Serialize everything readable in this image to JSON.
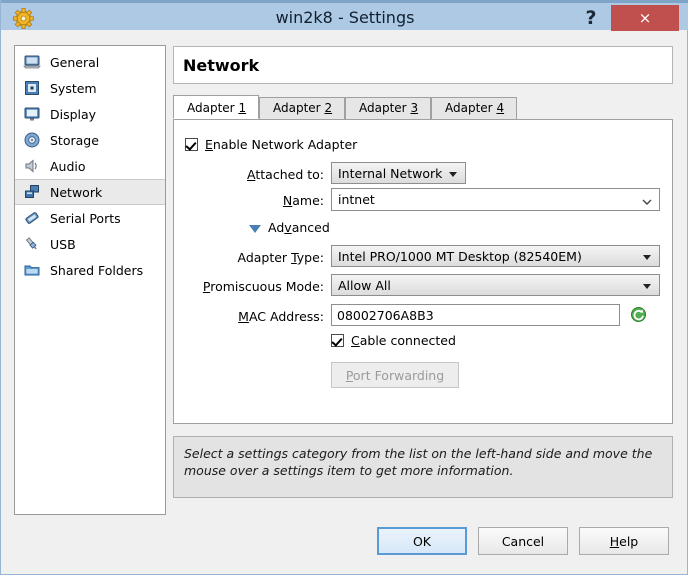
{
  "titlebar": {
    "title": "win2k8 - Settings",
    "gear_icon": "vbox-gear-icon",
    "help_label": "?",
    "close_label": "×"
  },
  "sidebar": {
    "items": [
      {
        "label": "General",
        "icon": "monitor-icon",
        "selected": false
      },
      {
        "label": "System",
        "icon": "chip-icon",
        "selected": false
      },
      {
        "label": "Display",
        "icon": "display-icon",
        "selected": false
      },
      {
        "label": "Storage",
        "icon": "disc-icon",
        "selected": false
      },
      {
        "label": "Audio",
        "icon": "speaker-icon",
        "selected": false
      },
      {
        "label": "Network",
        "icon": "network-icon",
        "selected": true
      },
      {
        "label": "Serial Ports",
        "icon": "serial-port-icon",
        "selected": false
      },
      {
        "label": "USB",
        "icon": "usb-icon",
        "selected": false
      },
      {
        "label": "Shared Folders",
        "icon": "shared-folder-icon",
        "selected": false
      }
    ]
  },
  "header": {
    "title": "Network"
  },
  "tabs": [
    {
      "label": "Adapter",
      "mnemonic": "1",
      "active": true
    },
    {
      "label": "Adapter",
      "mnemonic": "2",
      "active": false
    },
    {
      "label": "Adapter",
      "mnemonic": "3",
      "active": false
    },
    {
      "label": "Adapter",
      "mnemonic": "4",
      "active": false
    }
  ],
  "form": {
    "enable_adapter": {
      "label_pre": "E",
      "label_post": "nable Network Adapter",
      "checked": true
    },
    "attached_to": {
      "label_pre": "A",
      "label_post": "ttached to:",
      "value": "Internal Network"
    },
    "name": {
      "label_pre": "N",
      "label_post": "ame:",
      "value": "intnet"
    },
    "advanced": {
      "label_pre": "Ad",
      "label_mid": "v",
      "label_post": "anced",
      "expanded": true
    },
    "adapter_type": {
      "label_pre": "Adapter ",
      "label_mid": "T",
      "label_post": "ype:",
      "value": "Intel PRO/1000 MT Desktop (82540EM)"
    },
    "promiscuous_mode": {
      "label_pre": "P",
      "label_post": "romiscuous Mode:",
      "value": "Allow All"
    },
    "mac_address": {
      "label_pre": "M",
      "label_post": "AC Address:",
      "value": "08002706A8B3",
      "refresh_icon": "refresh-icon"
    },
    "cable_connected": {
      "label_pre": "C",
      "label_post": "able connected",
      "checked": true
    },
    "port_forwarding": {
      "label_pre": "P",
      "label_post": "ort Forwarding",
      "enabled": false
    }
  },
  "info": {
    "text": "Select a settings category from the list on the left-hand side and move the mouse over a settings item to get more information."
  },
  "buttons": {
    "ok": "OK",
    "cancel": "Cancel",
    "help_pre": "H",
    "help_post": "elp"
  },
  "colors": {
    "titlebar": "#aec9e4",
    "close": "#c0504d",
    "selection": "#eaeaea",
    "accent": "#4a7fb5",
    "refresh_green": "#3fa63f"
  }
}
